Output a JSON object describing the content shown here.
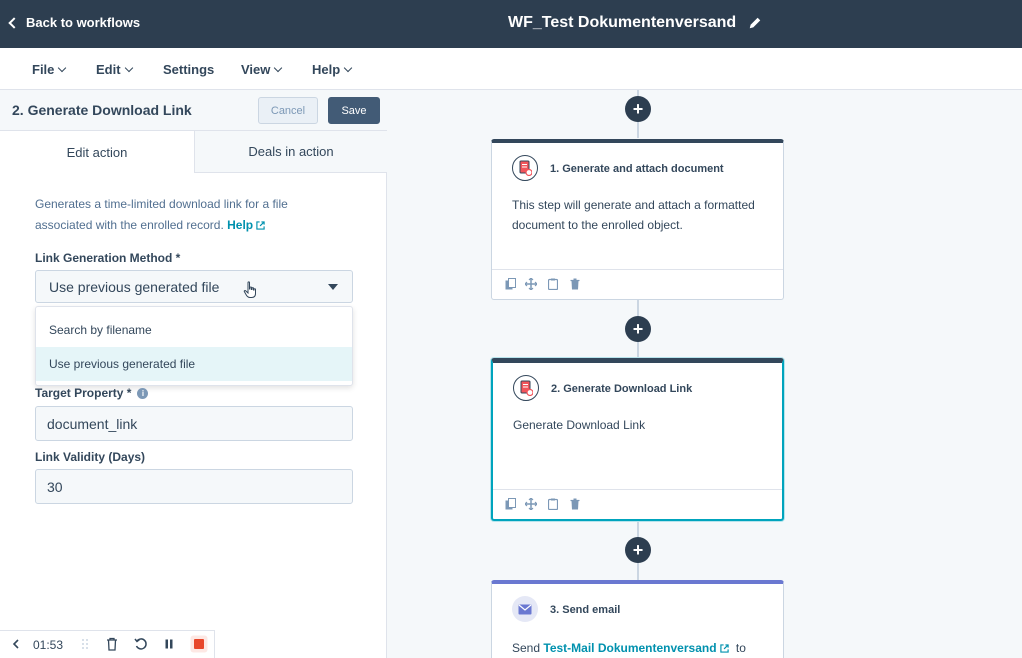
{
  "topbar": {
    "back_label": "Back to workflows",
    "workflow_title": "WF_Test Dokumentenversand"
  },
  "menu": {
    "items": [
      {
        "label": "File"
      },
      {
        "label": "Edit"
      },
      {
        "label": "Settings"
      },
      {
        "label": "View"
      },
      {
        "label": "Help"
      }
    ]
  },
  "panel": {
    "title": "2. Generate Download Link",
    "cancel_label": "Cancel",
    "save_label": "Save",
    "tabs": [
      {
        "label": "Edit action",
        "active": true
      },
      {
        "label": "Deals in action",
        "active": false
      }
    ],
    "description": "Generates a time-limited download link for a file associated with the enrolled record.",
    "help_label": "Help",
    "fields": {
      "method_label": "Link Generation Method *",
      "method_value": "Use previous generated file",
      "method_options": [
        "Search by filename",
        "Use previous generated file"
      ],
      "target_label": "Target Property *",
      "target_value": "document_link",
      "validity_label": "Link Validity (Days)",
      "validity_value": "30"
    }
  },
  "recorder": {
    "time": "01:53"
  },
  "workflow": {
    "steps": [
      {
        "title": "1. Generate and attach document",
        "body": "This step will generate and attach a formatted document to the enrolled object."
      },
      {
        "title": "2. Generate Download Link",
        "body": "Generate Download Link"
      },
      {
        "title": "3. Send email",
        "body_prefix": "Send",
        "body_link": "Test-Mail Dokumentenversand",
        "body_suffix": "to"
      }
    ]
  },
  "colors": {
    "topbar": "#2d3e50",
    "accent": "#0091ae",
    "active_border": "#00a4bd",
    "email_accent": "#6a78d1",
    "record_red": "#e8472b"
  },
  "icons": {
    "back": "chevron-left-icon",
    "edit": "pencil-icon",
    "document": "document-icon",
    "email": "envelope-icon",
    "clone": "copy-icon",
    "move": "move-icon",
    "clipboard": "clipboard-icon",
    "delete": "trash-icon",
    "add": "plus-icon"
  }
}
